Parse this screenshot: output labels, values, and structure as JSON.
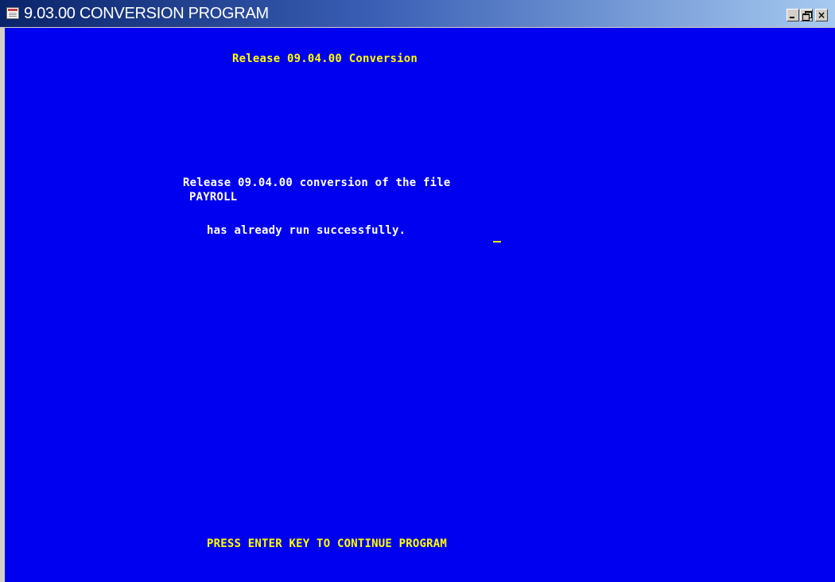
{
  "window": {
    "title": "9.03.00 CONVERSION PROGRAM",
    "icon": "terminal-app-icon",
    "controls": {
      "minimize": "minimize-icon",
      "restore": "restore-icon",
      "close_glyph": "×"
    }
  },
  "terminal": {
    "heading": "Release 09.04.00 Conversion",
    "message_line1": "Release 09.04.00 conversion of the file",
    "file_name": "PAYROLL",
    "message_line2": "has already run successfully.",
    "prompt": "PRESS ENTER KEY TO CONTINUE PROGRAM",
    "colors": {
      "background": "#0000f0",
      "heading": "#ffff00",
      "body": "#ffffff",
      "cursor": "#ffff00"
    }
  }
}
